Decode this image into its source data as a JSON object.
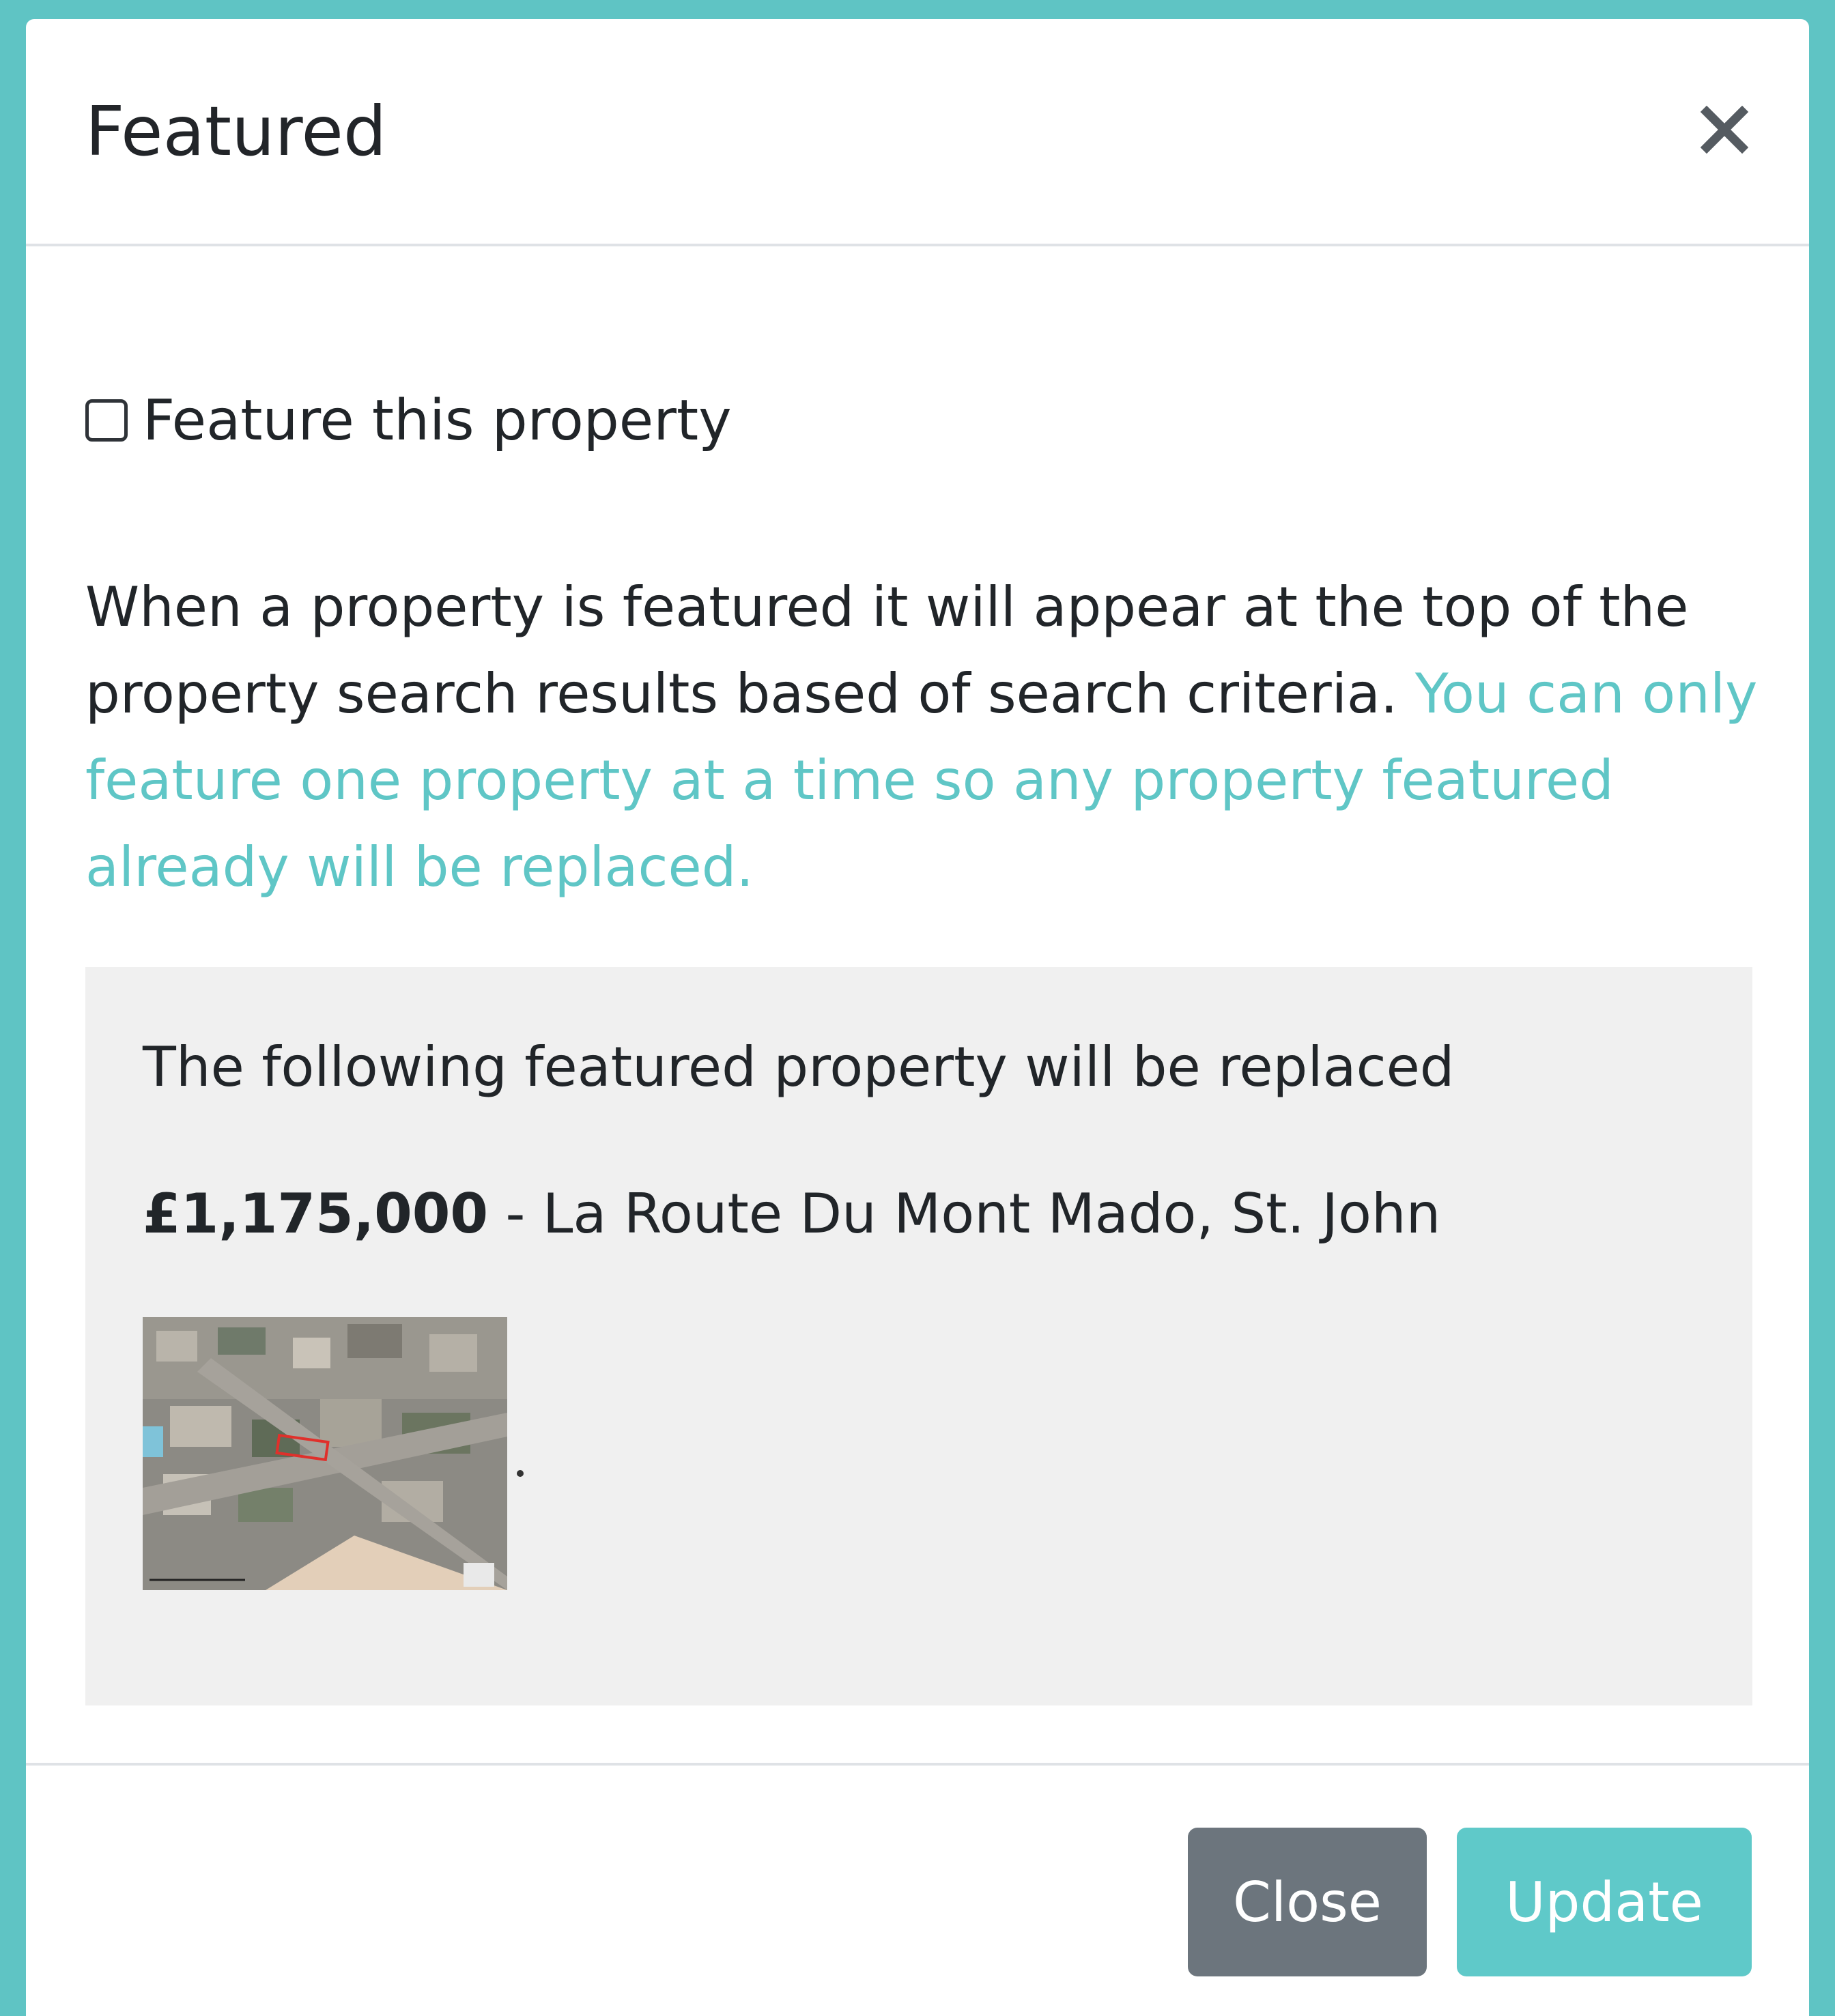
{
  "modal": {
    "title": "Featured",
    "close_icon": "close-icon"
  },
  "checkbox": {
    "label": "Feature this property",
    "checked": false
  },
  "description": {
    "text": "When a property is featured it will appear at the top of the property search results based of search criteria. ",
    "highlight": "You can only feature one property at a time so any property featured already will be replaced."
  },
  "replace_box": {
    "heading": "The following featured property will be replaced",
    "price": "£1,175,000",
    "separator": " - ",
    "address": "La Route Du Mont Mado, St. John"
  },
  "footer": {
    "close_label": "Close",
    "update_label": "Update"
  },
  "colors": {
    "accent": "#5fc6c6",
    "close_button": "#6c757d",
    "update_button": "#5fc9c9",
    "panel_background": "#f0f0f0"
  }
}
